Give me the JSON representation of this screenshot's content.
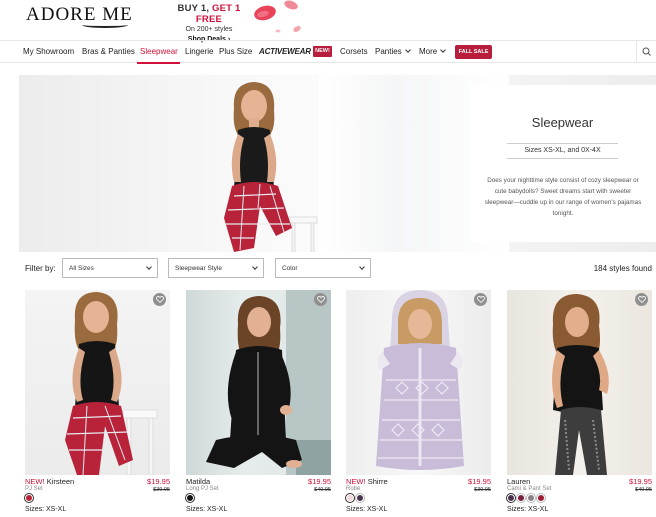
{
  "header": {
    "logo": "ADORE ME",
    "promo": {
      "title_prefix": "BUY 1,",
      "title_accent": "GET 1 FREE",
      "subtitle": "On 200+ styles",
      "link": "Shop Deals ›"
    }
  },
  "nav": {
    "items": [
      "My Showroom",
      "Bras & Panties",
      "Sleepwear",
      "Lingerie",
      "Plus Size",
      "ACTIVEWEAR",
      "Corsets",
      "Panties",
      "More"
    ],
    "active": "Sleepwear",
    "new_badge": "NEW!",
    "sale_badge": "FALL SALE",
    "search_icon": "search-icon"
  },
  "hero": {
    "title": "Sleepwear",
    "sizes": "Sizes XS-XL, and 0X-4X",
    "description": "Does your nighttime style consist of cozy sleepwear or cute babydolls? Sweet dreams start with sweeter sleepwear—cuddle up in our range of women's pajamas tonight."
  },
  "filters": {
    "label": "Filter by:",
    "selects": [
      {
        "value": "All Sizes"
      },
      {
        "value": "Sleepwear Style"
      },
      {
        "value": "Color"
      }
    ],
    "results": "184 styles found"
  },
  "products": [
    {
      "new": "NEW!",
      "name": "Kirsteen",
      "type": "PJ Set",
      "price": "$19.95",
      "old_price": "$39.95",
      "swatches": [
        "#b8233a"
      ],
      "sizes": "Sizes: XS-XL"
    },
    {
      "new": "",
      "name": "Matilda",
      "type": "Long PJ Set",
      "price": "$19.95",
      "old_price": "$49.95",
      "swatches": [
        "#111111"
      ],
      "sizes": "Sizes: XS-XL"
    },
    {
      "new": "NEW!",
      "name": "Shirre",
      "type": "Robe",
      "price": "$19.95",
      "old_price": "$39.95",
      "swatches": [
        "#f2d6dc",
        "#4a3350"
      ],
      "sizes": "Sizes: XS-XL"
    },
    {
      "new": "",
      "name": "Lauren",
      "type": "Cami & Pant Set",
      "price": "$19.95",
      "old_price": "$49.95",
      "swatches": [
        "#4a3350",
        "#7a1f3d",
        "#8c7f8a",
        "#9e1c33"
      ],
      "sizes": "Sizes: XS-XL"
    }
  ],
  "colors": {
    "accent": "#d0113a",
    "badge": "#b81d3c"
  }
}
